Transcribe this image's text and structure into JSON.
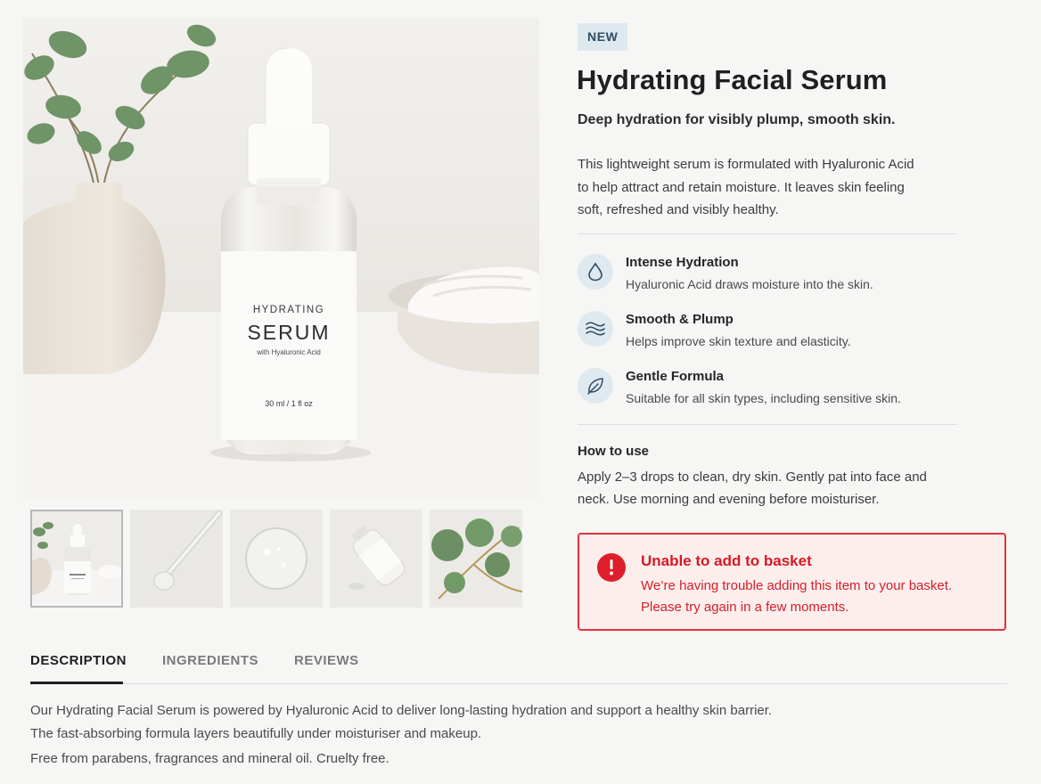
{
  "gallery": {
    "main_image": {
      "label_line1": "HYDRATING",
      "label_line2": "SERUM",
      "label_line3": "with Hyaluronic Acid",
      "label_volume": "30 ml / 1 fl oz"
    },
    "thumbnails": [
      {
        "name": "bottle",
        "selected": true
      },
      {
        "name": "dropper",
        "selected": false
      },
      {
        "name": "serum-drop",
        "selected": false
      },
      {
        "name": "bottle-on-side",
        "selected": false
      },
      {
        "name": "eucalyptus",
        "selected": false
      }
    ]
  },
  "product": {
    "badge": "NEW",
    "title": "Hydrating Facial Serum",
    "subtitle": "Deep hydration for visibly plump, smooth skin.",
    "description_lines": [
      "This lightweight serum is formulated with Hyaluronic Acid",
      "to help attract and retain moisture. It leaves skin feeling",
      "soft, refreshed and visibly healthy."
    ],
    "features": [
      {
        "icon": "water-drop-icon",
        "title": "Intense Hydration",
        "text": "Hyaluronic Acid draws moisture into the skin."
      },
      {
        "icon": "waves-icon",
        "title": "Smooth & Plump",
        "text": "Helps improve skin texture and elasticity."
      },
      {
        "icon": "leaf-icon",
        "title": "Gentle Formula",
        "text": "Suitable for all skin types, including sensitive skin."
      }
    ],
    "how_to_use": {
      "title": "How to use",
      "lines": [
        "Apply 2–3 drops to clean, dry skin. Gently pat into face and",
        "neck. Use morning and evening before moisturiser."
      ]
    }
  },
  "alert": {
    "icon": "exclamation-icon",
    "title": "Unable to add to basket",
    "lines": [
      "We’re having trouble adding this item to your basket.",
      "Please try again in a few moments."
    ],
    "color": "#dc1f2a"
  },
  "tabs": {
    "items": [
      {
        "label": "DESCRIPTION",
        "active": true
      },
      {
        "label": "INGREDIENTS",
        "active": false
      },
      {
        "label": "REVIEWS",
        "active": false
      }
    ],
    "description_lines": [
      "Our Hydrating Facial Serum is powered by Hyaluronic Acid to deliver long-lasting hydration and support a healthy skin barrier.",
      "The fast-absorbing formula layers beautifully under moisturiser and makeup.",
      "Free from parabens, fragrances and mineral oil. Cruelty free."
    ]
  },
  "colors": {
    "accent_error": "#dc1f2a",
    "badge_bg": "#dde8ef",
    "feature_icon_bg": "#dfe9f0"
  }
}
